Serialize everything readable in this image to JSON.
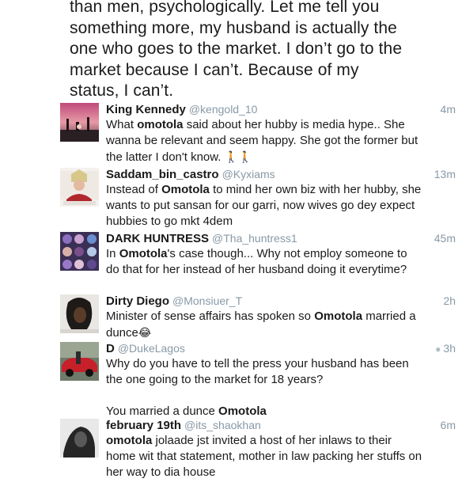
{
  "quote_lines": [
    "than men, psychologically. Let me tell you",
    "something more, my husband is actually the",
    "one who goes to the market. I don’t go to the",
    "market because I can’t. Because of my",
    "status, I can’t."
  ],
  "tweets": [
    {
      "name": "King Kennedy",
      "handle": "@kengold_10",
      "time": "4m",
      "avatar": "sunset-avatar",
      "text_parts": [
        "What ",
        "omotola",
        " said about her hubby is media hype.. She wanna be relevant and seem happy. She got the former but the latter I don't know. ",
        "🚶🚶"
      ]
    },
    {
      "name": "Saddam_bin_castro",
      "handle": "@Kyxiams",
      "time": "13m",
      "avatar": "pope-avatar",
      "text_parts": [
        "Instead of ",
        "Omotola",
        " to mind her own biz with her hubby, she wants to put sansan for our garri, now wives go dey expect hubbies to go mkt 4dem"
      ]
    },
    {
      "name": "DARK HUNTRESS",
      "handle": "@Tha_huntress1",
      "time": "45m",
      "avatar": "collage-avatar",
      "text_parts": [
        "In ",
        "Omotola",
        "'s case though... Why not employ someone to do that for her instead of her husband doing it everytime?"
      ]
    },
    {
      "name": "Dirty Diego",
      "handle": "@Monsiuer_T",
      "time": "2h",
      "avatar": "woman-avatar",
      "text_parts": [
        "Minister of sense affairs has spoken so ",
        "Omotola",
        " married a dunce",
        "😂"
      ]
    },
    {
      "name": "D",
      "handle": "@DukeLagos",
      "time": "3h",
      "avatar": "car-avatar",
      "text_parts": [
        "Why do you have to tell the press your husband has been the one going to the market for 18 years?",
        "You married a dunce ",
        "Omotola"
      ]
    },
    {
      "name": "february 19th",
      "handle": "@its_shaokhan",
      "time": "6m",
      "avatar": "bw-avatar",
      "text_parts": [
        "omotola",
        " jolaade jst invited a host of her inlaws to their home wit that statement, mother in law packing her stuffs on her way to dia house"
      ]
    }
  ],
  "colors": {
    "text": "#1a1a1a",
    "meta": "#8899a6"
  }
}
